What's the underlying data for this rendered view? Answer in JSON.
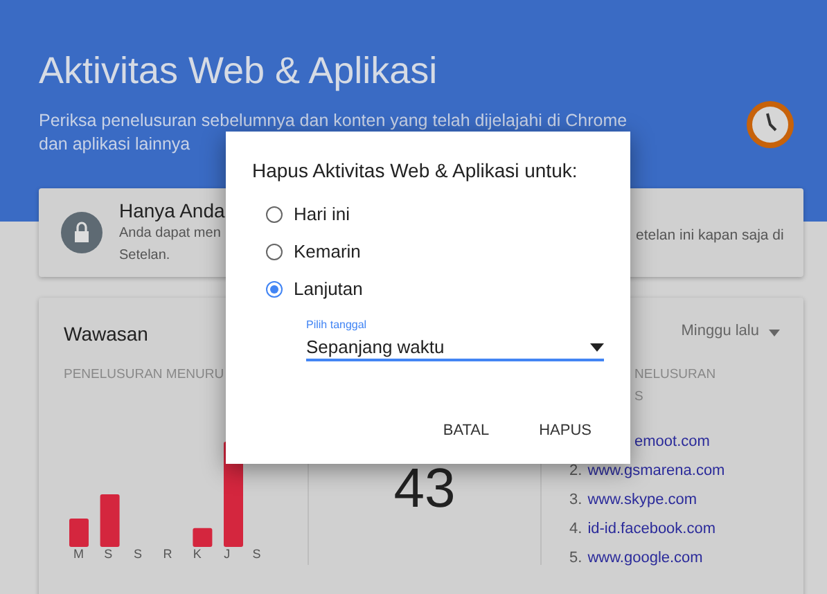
{
  "header": {
    "title": "Aktivitas Web & Aplikasi",
    "subtitle_lines": [
      "Periksa penelusuran sebelumnya dan konten yang telah dijelajahi di Chrome",
      "dan aplikasi lainnya"
    ]
  },
  "privacy_card": {
    "title": "Hanya Anda",
    "text_left_lines": [
      "Anda dapat men",
      "Setelan."
    ],
    "text_right": "etelan ini kapan saja di"
  },
  "insights": {
    "title": "Wawasan",
    "chart_heading": "PENELUSURAN MENURU",
    "days": [
      {
        "label": "M"
      },
      {
        "label": "S"
      },
      {
        "label": "S"
      },
      {
        "label": "R"
      },
      {
        "label": "K"
      },
      {
        "label": "J"
      },
      {
        "label": "S"
      }
    ],
    "total": "43",
    "period": "Minggu lalu",
    "top_heading_lines": [
      "NELUSURAN",
      "S"
    ],
    "top_sites": [
      {
        "site": "emoot.com"
      },
      {
        "number": "2.",
        "site": "www.gsmarena.com"
      },
      {
        "number": "3.",
        "site": "www.skype.com"
      },
      {
        "number": "4.",
        "site": "id-id.facebook.com"
      },
      {
        "number": "5.",
        "site": "www.google.com"
      }
    ]
  },
  "dialog": {
    "title": "Hapus Aktivitas Web & Aplikasi untuk:",
    "options": [
      {
        "label": "Hari ini",
        "selected": false
      },
      {
        "label": "Kemarin",
        "selected": false
      },
      {
        "label": "Lanjutan",
        "selected": true
      }
    ],
    "date_field": {
      "label": "Pilih tanggal",
      "value": "Sepanjang waktu"
    },
    "buttons": [
      "BATAL",
      "HAPUS"
    ]
  }
}
